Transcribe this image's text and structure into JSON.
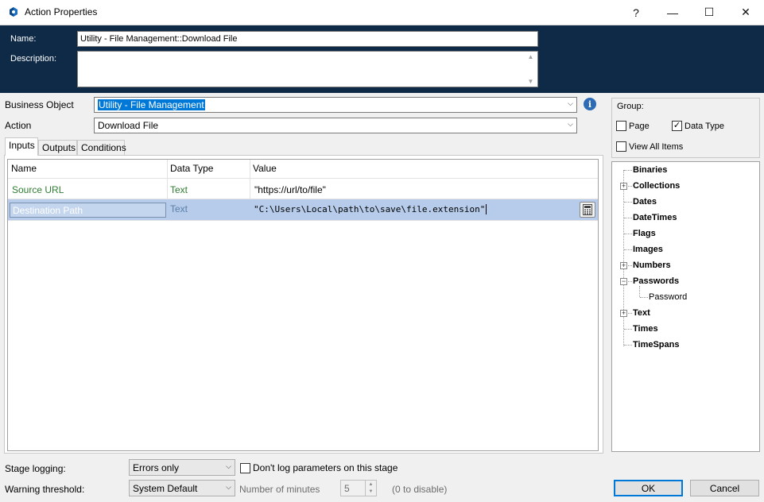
{
  "window": {
    "title": "Action Properties",
    "help_glyph": "?",
    "minimize_glyph": "—",
    "maximize_glyph": "☐",
    "close_glyph": "✕"
  },
  "header": {
    "name_label": "Name:",
    "name_value": "Utility - File Management::Download File",
    "description_label": "Description:",
    "description_value": ""
  },
  "business_object": {
    "label": "Business Object",
    "value": "Utility - File Management"
  },
  "action": {
    "label": "Action",
    "value": "Download File"
  },
  "tabs": [
    {
      "label": "Inputs",
      "active": true
    },
    {
      "label": "Outputs",
      "active": false
    },
    {
      "label": "Conditions",
      "active": false
    }
  ],
  "grid": {
    "columns": [
      "Name",
      "Data Type",
      "Value"
    ],
    "rows": [
      {
        "name": "Source URL",
        "data_type": "Text",
        "value": "\"https://url/to/file\""
      },
      {
        "name": "Destination Path",
        "data_type": "Text",
        "value": "\"C:\\Users\\Local\\path\\to\\save\\file.extension\""
      }
    ],
    "row_text_color": "#2e7d32",
    "selected_row_color": "#b6ccea"
  },
  "group": {
    "label": "Group:",
    "page_label": "Page",
    "page_checked": false,
    "data_type_label": "Data Type",
    "data_type_checked": true,
    "view_all_label": "View All Items",
    "view_all_checked": false
  },
  "tree": [
    {
      "label": "Binaries",
      "expandable": false
    },
    {
      "label": "Collections",
      "expandable": true,
      "expanded": false
    },
    {
      "label": "Dates",
      "expandable": false
    },
    {
      "label": "DateTimes",
      "expandable": false
    },
    {
      "label": "Flags",
      "expandable": false
    },
    {
      "label": "Images",
      "expandable": false
    },
    {
      "label": "Numbers",
      "expandable": true,
      "expanded": false
    },
    {
      "label": "Passwords",
      "expandable": true,
      "expanded": true,
      "children": [
        "Password"
      ]
    },
    {
      "label": "Text",
      "expandable": true,
      "expanded": false
    },
    {
      "label": "Times",
      "expandable": false
    },
    {
      "label": "TimeSpans",
      "expandable": false
    }
  ],
  "footer": {
    "stage_logging_label": "Stage logging:",
    "stage_logging_value": "Errors only",
    "dont_log_label": "Don't log parameters on this stage",
    "dont_log_checked": false,
    "warning_threshold_label": "Warning threshold:",
    "warning_threshold_value": "System Default",
    "minutes_label": "Number of minutes",
    "minutes_value": "5",
    "disable_hint": "(0 to disable)",
    "ok_label": "OK",
    "cancel_label": "Cancel"
  },
  "colors": {
    "header_bg": "#0e2a47",
    "accent": "#0078d7"
  }
}
